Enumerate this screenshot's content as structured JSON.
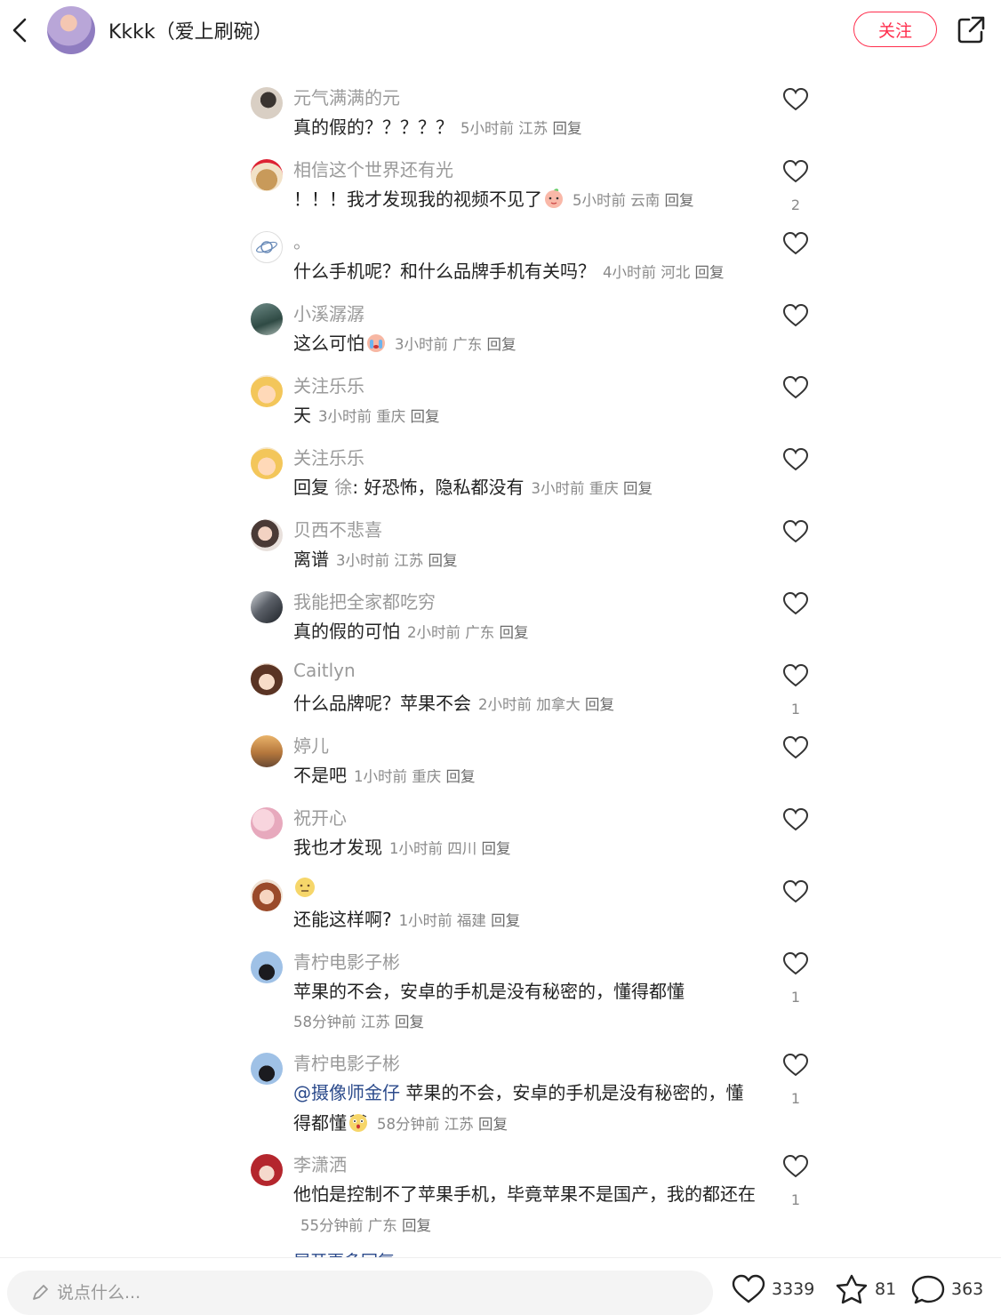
{
  "header": {
    "author_name": "Kkkk（爱上刷碗）",
    "follow_label": "关注"
  },
  "comments": [
    {
      "user": "元气满满的元",
      "text": "真的假的？？？？？",
      "time": "5小时前",
      "location": "江苏",
      "reply": "回复",
      "likes": ""
    },
    {
      "user": "相信这个世界还有光",
      "text": "！！！我才发现我的视频不见了",
      "time": "5小时前",
      "location": "云南",
      "reply": "回复",
      "likes": "2"
    },
    {
      "user": "。",
      "text": "什么手机呢？和什么品牌手机有关吗？",
      "time": "4小时前",
      "location": "河北",
      "reply": "回复",
      "likes": ""
    },
    {
      "user": "小溪潺潺",
      "text": "这么可怕",
      "time": "3小时前",
      "location": "广东",
      "reply": "回复",
      "likes": ""
    },
    {
      "user": "关注乐乐",
      "text": "天",
      "time": "3小时前",
      "location": "重庆",
      "reply": "回复",
      "likes": ""
    },
    {
      "user": "关注乐乐",
      "reply_prefix": "回复",
      "reply_to": "徐",
      "text": ": 好恐怖，隐私都没有",
      "time": "3小时前",
      "location": "重庆",
      "reply": "回复",
      "likes": ""
    },
    {
      "user": "贝西不悲喜",
      "text": "离谱",
      "time": "3小时前",
      "location": "江苏",
      "reply": "回复",
      "likes": ""
    },
    {
      "user": "我能把全家都吃穷",
      "text": "真的假的可怕",
      "time": "2小时前",
      "location": "广东",
      "reply": "回复",
      "likes": ""
    },
    {
      "user": "Caitlyn",
      "text": "什么品牌呢？苹果不会",
      "time": "2小时前",
      "location": "加拿大",
      "reply": "回复",
      "likes": "1"
    },
    {
      "user": "婷儿",
      "text": "不是吧",
      "time": "1小时前",
      "location": "重庆",
      "reply": "回复",
      "likes": ""
    },
    {
      "user": "祝开心",
      "text": "我也才发现",
      "time": "1小时前",
      "location": "四川",
      "reply": "回复",
      "likes": ""
    },
    {
      "user": "",
      "text": "还能这样啊?",
      "time": "1小时前",
      "location": "福建",
      "reply": "回复",
      "likes": ""
    },
    {
      "user": "青柠电影子彬",
      "text": "苹果的不会，安卓的手机是没有秘密的，懂得都懂",
      "time": "58分钟前",
      "location": "江苏",
      "reply": "回复",
      "likes": "1"
    },
    {
      "user": "青柠电影子彬",
      "mention": "@摄像师金仔",
      "text": " 苹果的不会，安卓的手机是没有秘密的，懂得都懂",
      "time": "58分钟前",
      "location": "江苏",
      "reply": "回复",
      "likes": "1"
    },
    {
      "user": "李潇洒",
      "text": "他怕是控制不了苹果手机，毕竟苹果不是国产，我的都还在",
      "time": "55分钟前",
      "location": "广东",
      "reply": "回复",
      "likes": "1"
    }
  ],
  "expand_replies": "展开更多回复",
  "bottom_bar": {
    "input_placeholder": "说点什么...",
    "likes_count": "3339",
    "collects_count": "81",
    "comments_count": "363"
  },
  "colors": {
    "accent": "#ff2e4d",
    "mention": "#2b4a8b",
    "secondary_text": "#9a9a9a"
  }
}
